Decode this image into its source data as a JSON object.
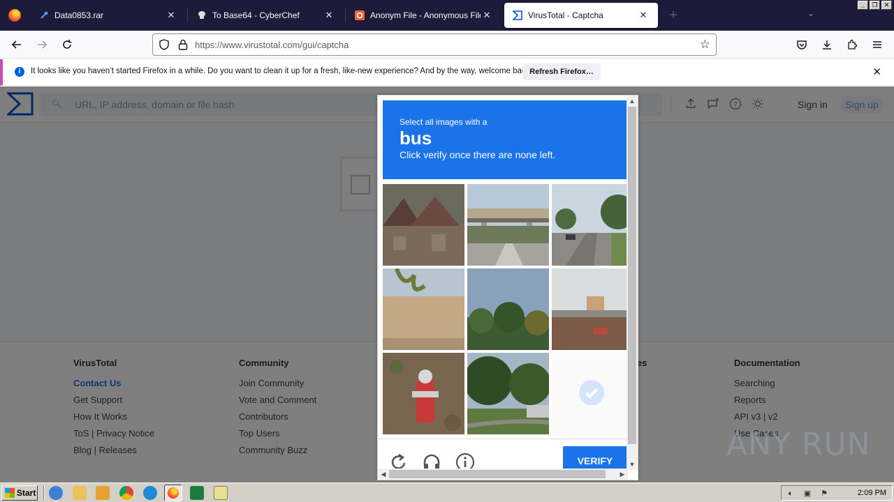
{
  "tabs": [
    {
      "title": "Data0853.rar",
      "icon": "download-icon",
      "active": false
    },
    {
      "title": "To Base64 - CyberChef",
      "icon": "chef-hat-icon",
      "active": false
    },
    {
      "title": "Anonym File - Anonymous File Uplo",
      "icon": "anonymfile-icon",
      "active": false
    },
    {
      "title": "VirusTotal - Captcha",
      "icon": "virustotal-icon",
      "active": true
    }
  ],
  "url": "https://www.virustotal.com/gui/captcha",
  "notification": {
    "message": "It looks like you haven’t started Firefox in a while. Do you want to clean it up for a fresh, like-new experience? And by the way, welcome back!",
    "button": "Refresh Firefox…"
  },
  "vt": {
    "search_placeholder": "URL, IP address, domain or file hash",
    "sign_in": "Sign in",
    "sign_up": "Sign up"
  },
  "captcha": {
    "instruction_line1": "Select all images with a",
    "target_word": "bus",
    "instruction_line3": "Click verify once there are none left.",
    "verify_label": "VERIFY",
    "tiles": [
      "house-roof",
      "highway-overpass",
      "residential-street",
      "wall-palm",
      "trees-sky",
      "parking-lot",
      "fire-hydrant",
      "trees-road",
      "empty-selected"
    ]
  },
  "footer": {
    "columns": [
      {
        "heading": "VirusTotal",
        "links": [
          "Contact Us",
          "Get Support",
          "How It Works",
          "ToS | Privacy Notice",
          "Blog | Releases"
        ]
      },
      {
        "heading": "Community",
        "links": [
          "Join Community",
          "Vote and Comment",
          "Contributors",
          "Top Users",
          "Community Buzz"
        ]
      },
      {
        "heading": "es",
        "links": []
      },
      {
        "heading": "Documentation",
        "links": [
          "Searching",
          "Reports",
          "API v3 | v2",
          "Use Cases"
        ]
      }
    ]
  },
  "watermark": "ANY RUN",
  "taskbar": {
    "start": "Start",
    "time": "2:09 PM"
  },
  "colors": {
    "accent": "#1a73e8",
    "tabstrip": "#1c1b3a",
    "notification_border": "#c54eb7"
  }
}
